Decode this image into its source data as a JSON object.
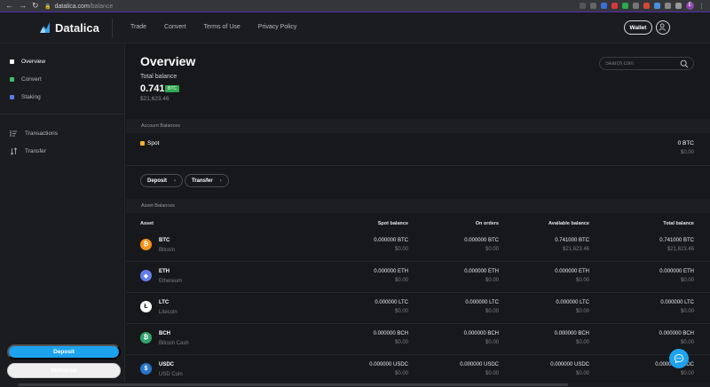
{
  "browser": {
    "url_host": "datalica.com",
    "url_path": "/balance"
  },
  "brand": {
    "name": "Datalica"
  },
  "topnav": {
    "items": [
      "Trade",
      "Convert",
      "Terms of Use",
      "Privacy Policy"
    ],
    "wallet_label": "Wallet"
  },
  "sidebar": {
    "items": [
      {
        "label": "Overview",
        "color": "#ffffff"
      },
      {
        "label": "Convert",
        "color": "#3fbf6a"
      },
      {
        "label": "Staking",
        "color": "#5b7be6"
      },
      {
        "label": "Transactions"
      },
      {
        "label": "Transfer"
      }
    ],
    "deposit_label": "Deposit",
    "withdraw_label": "Withdraw"
  },
  "overview": {
    "title": "Overview",
    "total_balance_label": "Total balance",
    "total_balance_value": "0.741",
    "total_balance_unit": "BTC",
    "total_balance_usd": "$21,623.46",
    "search_placeholder": "Search coin"
  },
  "account_balances": {
    "section_label": "Account Balances",
    "spot_label": "Spot",
    "spot_value": "0 BTC",
    "spot_usd": "$0.00",
    "deposit_label": "Deposit",
    "transfer_label": "Transfer"
  },
  "asset_balances": {
    "section_label": "Asset Balances",
    "columns": [
      "Asset",
      "Spot balance",
      "On orders",
      "Available balance",
      "Total balance"
    ],
    "rows": [
      {
        "symbol": "BTC",
        "name": "Bitcoin",
        "icon": "bitcoin-icon",
        "color": "#f7931a",
        "glyph": "₿",
        "spot": "0.000000 BTC",
        "spot_usd": "$0.00",
        "orders": "0.000000 BTC",
        "orders_usd": "$0.00",
        "available": "0.741000 BTC",
        "available_usd": "$21,623.46",
        "total": "0.741000 BTC",
        "total_usd": "$21,623.46"
      },
      {
        "symbol": "ETH",
        "name": "Ethereum",
        "icon": "ethereum-icon",
        "color": "#627eea",
        "glyph": "◆",
        "spot": "0.000000 ETH",
        "spot_usd": "$0.00",
        "orders": "0.000000 ETH",
        "orders_usd": "$0.00",
        "available": "0.000000 ETH",
        "available_usd": "$0.00",
        "total": "0.000000 ETH",
        "total_usd": "$0.00"
      },
      {
        "symbol": "LTC",
        "name": "Litecoin",
        "icon": "litecoin-icon",
        "color": "#ffffff",
        "glyph": "Ł",
        "spot": "0.000000 LTC",
        "spot_usd": "$0.00",
        "orders": "0.000000 LTC",
        "orders_usd": "$0.00",
        "available": "0.000000 LTC",
        "available_usd": "$0.00",
        "total": "0.000000 LTC",
        "total_usd": "$0.00"
      },
      {
        "symbol": "BCH",
        "name": "Bitcoin Cash",
        "icon": "bitcoin-cash-icon",
        "color": "#2ea36b",
        "glyph": "₿",
        "spot": "0.000000 BCH",
        "spot_usd": "$0.00",
        "orders": "0.000000 BCH",
        "orders_usd": "$0.00",
        "available": "0.000000 BCH",
        "available_usd": "$0.00",
        "total": "0.000000 BCH",
        "total_usd": "$0.00"
      },
      {
        "symbol": "USDC",
        "name": "USD Coin",
        "icon": "usd-coin-icon",
        "color": "#2775ca",
        "glyph": "$",
        "spot": "0.000000 USDC",
        "spot_usd": "$0.00",
        "orders": "0.000000 USDC",
        "orders_usd": "$0.00",
        "available": "0.000000 USDC",
        "available_usd": "$0.00",
        "total": "0.000000 USDC",
        "total_usd": "$0.00"
      }
    ]
  }
}
